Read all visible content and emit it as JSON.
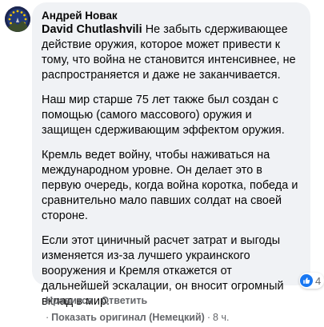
{
  "comment": {
    "author": "Андрей Новак",
    "mention": "David Chutlashvili",
    "paragraphs": [
      " Не забыть сдерживающее действие оружия, которое может привести к тому, что война не становится интенсивнее, не распространяется и даже не заканчивается.",
      "Наш мир старше 75 лет также был создан с помощью (самого массового) оружия и защищен сдерживающим эффектом оружия.",
      "Кремль ведет войну, чтобы наживаться на международном уровне. Он делает это в первую очередь, когда война коротка, победа и сравнительно мало павших солдат на своей стороне.",
      "Если этот циничный расчет затрат и выгоды изменяется из-за лучшего украинского вооружения и Кремля откажется от дальнейшей эскалации, он вносит огромный вклад в мир."
    ],
    "reaction_count": "4",
    "reaction_icon": "like-icon",
    "accent_color": "#1877f2"
  },
  "actions": {
    "like": "Нравится",
    "separator": "·",
    "reply": "Ответить",
    "show_original": "Показать оригинал (Немецкий)",
    "time": "8 ч."
  }
}
